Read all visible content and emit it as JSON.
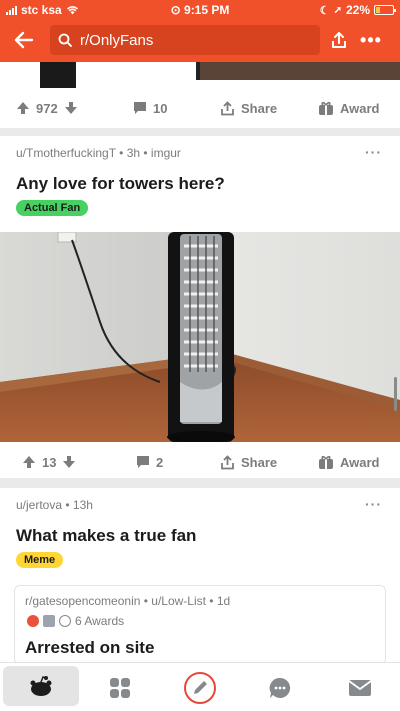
{
  "status": {
    "carrier": "stc ksa",
    "time": "9:15 PM",
    "battery": "22%",
    "battery_level": 0.22
  },
  "header": {
    "search_text": "r/OnlyFans"
  },
  "posts": [
    {
      "upvotes": "972",
      "comments": "10",
      "share_label": "Share",
      "award_label": "Award"
    },
    {
      "meta": "u/TmotherfuckingT • 3h • imgur",
      "title": "Any love for towers here?",
      "flair": "Actual Fan",
      "flair_color": "#46d160",
      "upvotes": "13",
      "comments": "2",
      "share_label": "Share",
      "award_label": "Award"
    },
    {
      "meta": "u/jertova • 13h",
      "title": "What makes a true fan",
      "flair": "Meme",
      "flair_color": "#ffd635",
      "crosspost": {
        "meta": "r/gatesopencomeonin • u/Low-List • 1d",
        "awards": "6 Awards",
        "title": "Arrested on site"
      }
    }
  ],
  "colors": {
    "brand": "#f0502a",
    "accent_compose": "#e8483a"
  }
}
